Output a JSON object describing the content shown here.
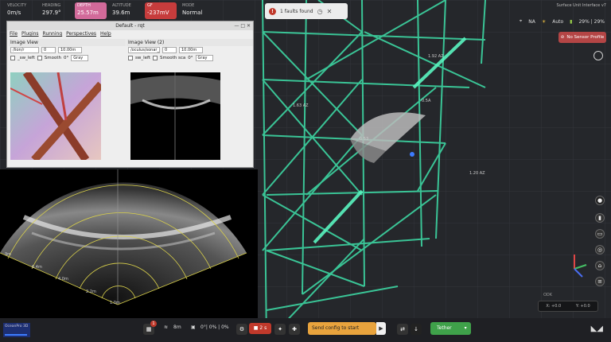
{
  "telemetry": [
    {
      "key": "VELOCITY",
      "value": "0m/s",
      "style": "plain"
    },
    {
      "key": "HEADING",
      "value": "297.9°",
      "style": "plain"
    },
    {
      "key": "DEPTH",
      "value": "25.57m",
      "style": "pink"
    },
    {
      "key": "ALTITUDE",
      "value": "39.6m",
      "style": "plain"
    },
    {
      "key": "GF",
      "value": "-237mV",
      "style": "red"
    },
    {
      "key": "MODE",
      "value": "Normal",
      "style": "plain"
    }
  ],
  "faults": {
    "label": "1 faults found"
  },
  "top_right": {
    "title": "Surface Unit Interface v7",
    "gps": "NA",
    "auto": "Auto",
    "battery": "29% | 29%",
    "no_sensor": "No Sensor Profile"
  },
  "image_window": {
    "title": "Default - rqt",
    "menu": [
      "File",
      "Plugins",
      "Running",
      "Perspectives",
      "Help"
    ],
    "left": {
      "title": "Image View",
      "topic": "/lion/r",
      "spin": "0",
      "scale": "10.00m",
      "check1": "_sw_left",
      "check2": "Smooth",
      "rot": "0°",
      "color": "Gray"
    },
    "right": {
      "title": "Image View (2)",
      "topic": "/oculus/sonar_",
      "spin": "0",
      "scale": "10.00m",
      "check1": "sw_left",
      "check2": "Smooth sca",
      "rot": "0°",
      "color": "Gray"
    }
  },
  "sonar": {
    "range_labels": [
      "1.0m",
      "2.2m",
      "4.0m",
      "6.4m",
      "9m"
    ]
  },
  "viewport": {
    "labels": [
      "1.92 AZ",
      "1.63 AZ",
      "1.20 AZ",
      "0.5A",
      "0.53"
    ]
  },
  "coords": {
    "label": "ODK",
    "x": "X: +0.0",
    "y": "Y: +0.0"
  },
  "bottom": {
    "panel": "OceanPro 3D",
    "wifi": "8m",
    "cpu": "0°| 0% | 0%",
    "rec": "2 s",
    "config": "Send config to start",
    "tether": "Tether",
    "badge": "1"
  },
  "colors": {
    "mesh": "#3ee0a9",
    "pink": "#d26a9a",
    "red": "#c63c3c",
    "orange": "#e8a33d",
    "green": "#3fa14a"
  }
}
